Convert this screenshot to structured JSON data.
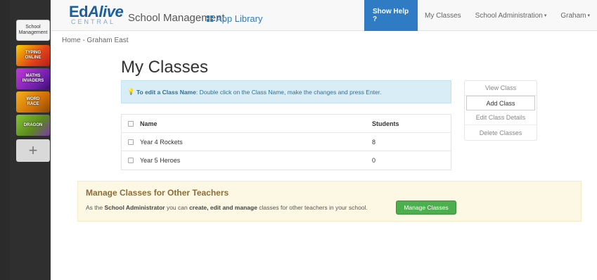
{
  "sidebar": {
    "active_app_label": "School Management",
    "apps": [
      {
        "label": "TYPING\nONLINE",
        "icon": "typing-online-icon"
      },
      {
        "label": "MATHS\nINVADERS",
        "icon": "maths-invaders-icon"
      },
      {
        "label": "WORD\nRACE",
        "icon": "word-game-icon"
      },
      {
        "label": "DRAGON",
        "icon": "dragon-game-icon"
      }
    ],
    "add_label": "+"
  },
  "header": {
    "logo_main_1": "Ed",
    "logo_main_2": "Alive",
    "logo_sub": "CENTRAL",
    "app_title": "School Management",
    "app_library": "App Library",
    "show_help": "Show Help ?",
    "nav": {
      "my_classes": "My Classes",
      "school_admin": "School Administration",
      "user": "Graham"
    }
  },
  "breadcrumb": "Home - Graham East",
  "main": {
    "title": "My Classes",
    "info": {
      "strong": "To edit a Class Name",
      "rest": ": Double click on the Class Name, make the changes and press Enter."
    },
    "table": {
      "headers": {
        "name": "Name",
        "students": "Students"
      },
      "rows": [
        {
          "name": "Year 4 Rockets",
          "students": "8"
        },
        {
          "name": "Year 5 Heroes",
          "students": "0"
        }
      ]
    },
    "actions": {
      "view": "View Class",
      "add": "Add Class",
      "edit": "Edit Class Details",
      "delete": "Delete Classes"
    }
  },
  "manage": {
    "title": "Manage Classes for Other Teachers",
    "text_1": "As the ",
    "text_role": "School Administrator",
    "text_2": " you can ",
    "text_actions": "create, edit and manage",
    "text_3": " classes for other teachers in your school.",
    "button": "Manage Classes"
  },
  "colors": {
    "brand_blue": "#1a5f9e",
    "help_blue": "#2f7bc4",
    "info_bg": "#d9edf7",
    "warning_bg": "#fcf8e3",
    "success_green": "#4cae4c"
  }
}
